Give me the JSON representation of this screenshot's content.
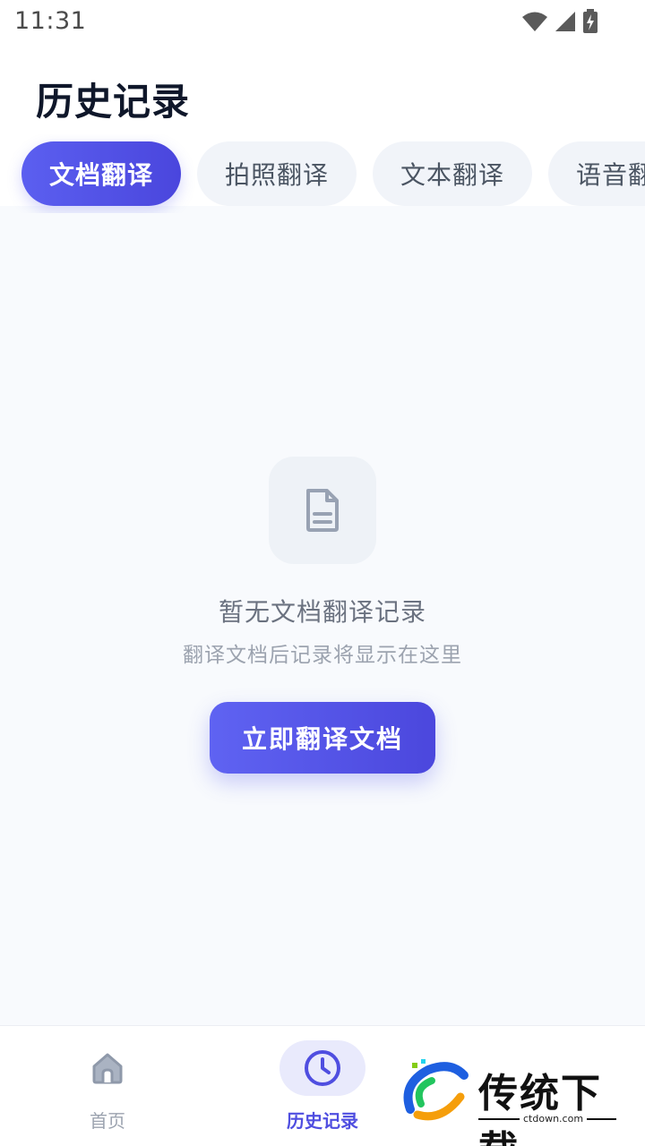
{
  "status_bar": {
    "time": "11:31",
    "icons": [
      "wifi-icon",
      "signal-icon",
      "battery-charging-icon"
    ]
  },
  "header": {
    "title": "历史记录"
  },
  "tabs": [
    {
      "label": "文档翻译",
      "active": true
    },
    {
      "label": "拍照翻译",
      "active": false
    },
    {
      "label": "文本翻译",
      "active": false
    },
    {
      "label": "语音翻译",
      "active": false
    }
  ],
  "empty_state": {
    "icon": "document-icon",
    "title": "暂无文档翻译记录",
    "subtitle": "翻译文档后记录将显示在这里",
    "button_label": "立即翻译文档"
  },
  "bottom_nav": {
    "items": [
      {
        "label": "首页",
        "icon": "home-icon",
        "active": false
      },
      {
        "label": "历史记录",
        "icon": "clock-icon",
        "active": true
      }
    ]
  },
  "watermark": {
    "text": "传统下载",
    "url": "ctdown.com"
  },
  "colors": {
    "accent": "#5b5ff0",
    "background": "#f8fafd",
    "tab_inactive": "#f1f4f9"
  }
}
